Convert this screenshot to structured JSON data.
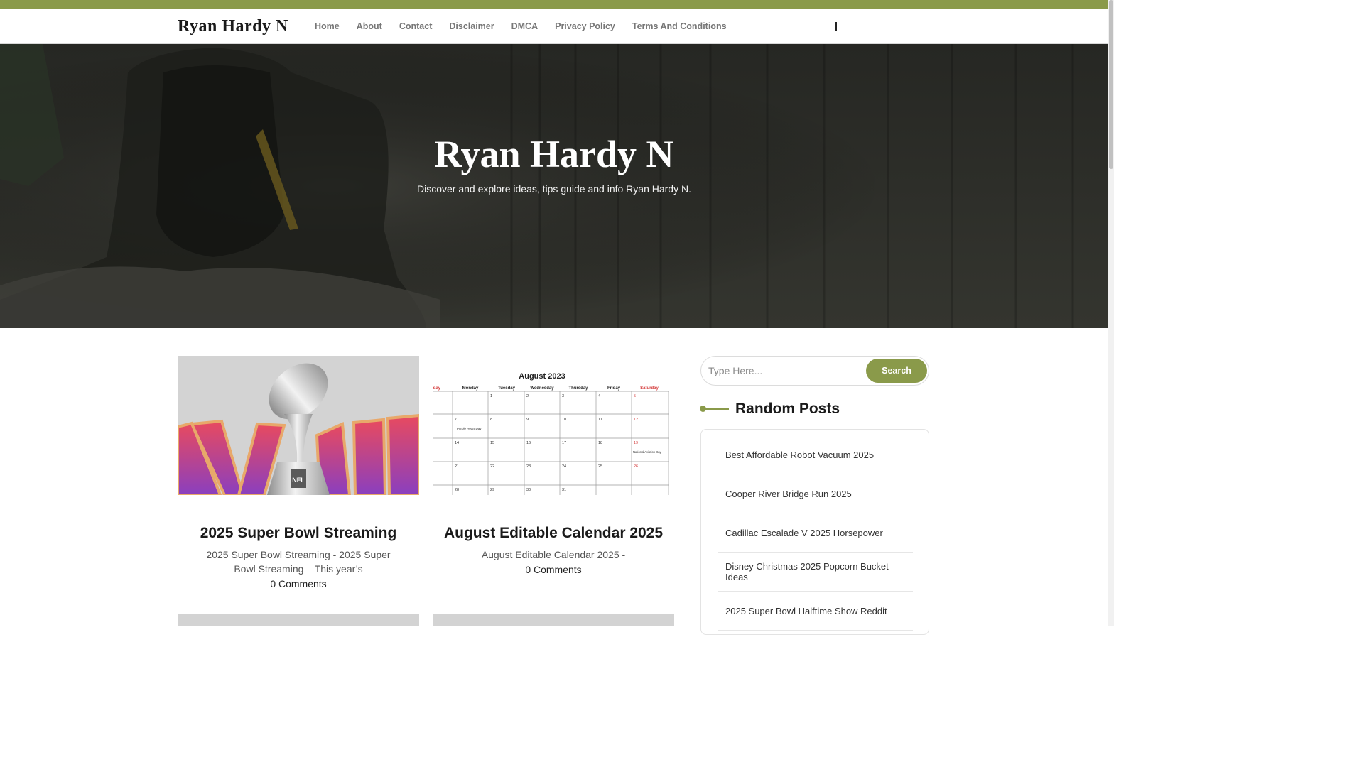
{
  "colors": {
    "accent": "#8a9a4a",
    "hero_overlay": "#2f302c"
  },
  "header": {
    "brand": "Ryan Hardy N",
    "nav": [
      "Home",
      "About",
      "Contact",
      "Disclaimer",
      "DMCA",
      "Privacy Policy",
      "Terms And Conditions"
    ]
  },
  "hero": {
    "title": "Ryan Hardy N",
    "subtitle": "Discover and explore ideas, tips guide and info Ryan Hardy N."
  },
  "posts": [
    {
      "title": "2025 Super Bowl Streaming",
      "excerpt": "2025 Super Bowl Streaming - 2025 Super Bowl Streaming – This year’s",
      "comments": "0 Comments",
      "thumb": "super-bowl-trophy"
    },
    {
      "title": "August Editable Calendar 2025",
      "excerpt": "August Editable Calendar 2025 -",
      "comments": "0 Comments",
      "thumb": "august-calendar",
      "calendar": {
        "month_title": "August 2023",
        "days": [
          "nday",
          "Monday",
          "Tuesday",
          "Wednesday",
          "Thursday",
          "Friday",
          "Saturday"
        ],
        "rows": [
          [
            "",
            "",
            "1",
            "2",
            "3",
            "4",
            "5"
          ],
          [
            "",
            "7",
            "8",
            "9",
            "10",
            "11",
            "12"
          ],
          [
            "",
            "14",
            "15",
            "16",
            "17",
            "18",
            "19"
          ],
          [
            "",
            "21",
            "22",
            "23",
            "24",
            "25",
            "26"
          ],
          [
            "",
            "28",
            "29",
            "30",
            "31",
            "",
            ""
          ]
        ],
        "events": {
          "purple_heart": "Purple Heart Day",
          "aviation": "National Aviation Day"
        }
      }
    }
  ],
  "sidebar": {
    "search": {
      "placeholder": "Type Here...",
      "button": "Search"
    },
    "random_title": "Random Posts",
    "random_posts": [
      "Best Affordable Robot Vacuum 2025",
      "Cooper River Bridge Run 2025",
      "Cadillac Escalade V 2025 Horsepower",
      "Disney Christmas 2025 Popcorn Bucket Ideas",
      "2025 Super Bowl Halftime Show Reddit"
    ]
  }
}
